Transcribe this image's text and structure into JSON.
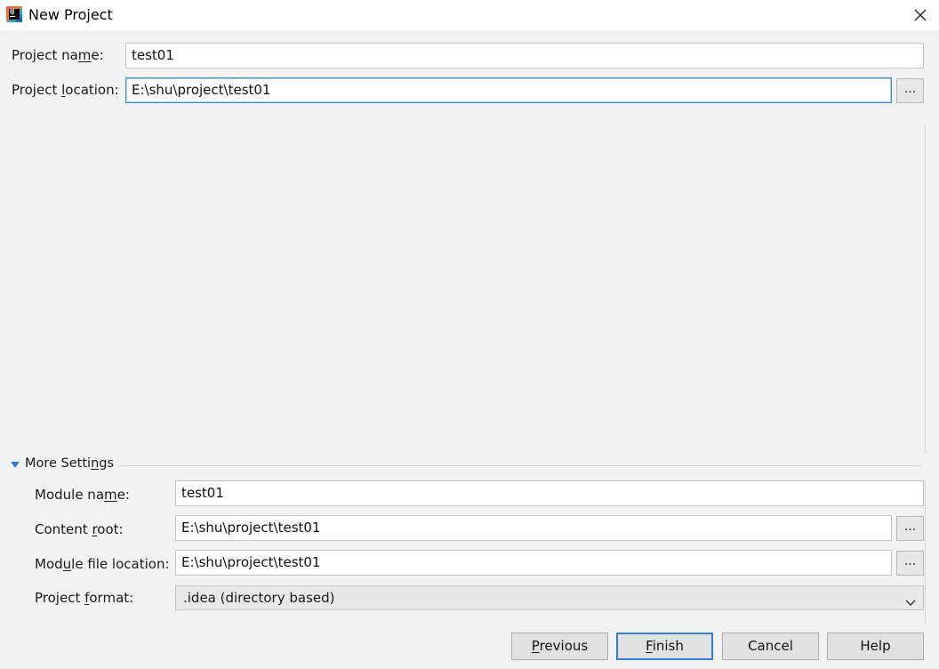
{
  "window": {
    "title": "New Project",
    "icon": "intellij-idea-icon",
    "close_icon": "close-icon"
  },
  "project": {
    "name_label": {
      "pre": "Project na",
      "key": "m",
      "post": "e:"
    },
    "name_value": "test01",
    "location_label": {
      "pre": "Project ",
      "key": "l",
      "post": "ocation:"
    },
    "location_value": "E:\\shu\\project\\test01",
    "browse_label": "..."
  },
  "more_settings": {
    "title": {
      "pre": "More Setti",
      "key": "n",
      "post": "gs"
    },
    "expanded": true,
    "module_name_label": {
      "pre": "Module na",
      "key": "m",
      "post": "e:"
    },
    "module_name_value": "test01",
    "content_root_label": {
      "pre": "Content ",
      "key": "r",
      "post": "oot:"
    },
    "content_root_value": "E:\\shu\\project\\test01",
    "module_file_label": {
      "pre": "Mod",
      "key": "u",
      "post": "le file location:"
    },
    "module_file_value": "E:\\shu\\project\\test01",
    "format_label": {
      "pre": "Project ",
      "key": "f",
      "post": "ormat:"
    },
    "format_value": ".idea (directory based)"
  },
  "buttons": {
    "previous": {
      "pre": "",
      "key": "P",
      "post": "revious"
    },
    "finish": {
      "pre": "",
      "key": "F",
      "post": "inish"
    },
    "cancel": "Cancel",
    "help": "Help"
  },
  "colors": {
    "accent": "#2f7fd4",
    "focus_border": "#3d8ee0",
    "background": "#f2f2f2"
  }
}
